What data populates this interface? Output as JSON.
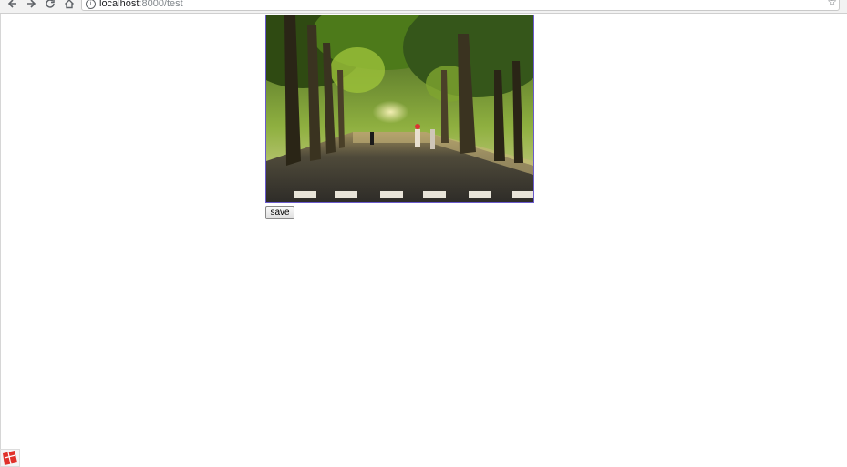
{
  "browser": {
    "url_host": "localhost",
    "url_rest": ":8000/test",
    "icons": {
      "back": "arrow-left-icon",
      "forward": "arrow-right-icon",
      "reload": "reload-icon",
      "home": "home-icon",
      "site_info": "info-icon",
      "bookmark": "star-icon"
    }
  },
  "main": {
    "photo_subject": "tree-lined street photo",
    "save_label": "save"
  },
  "colors": {
    "image_border": "#6a5acd",
    "logo_red": "#e0312a"
  }
}
